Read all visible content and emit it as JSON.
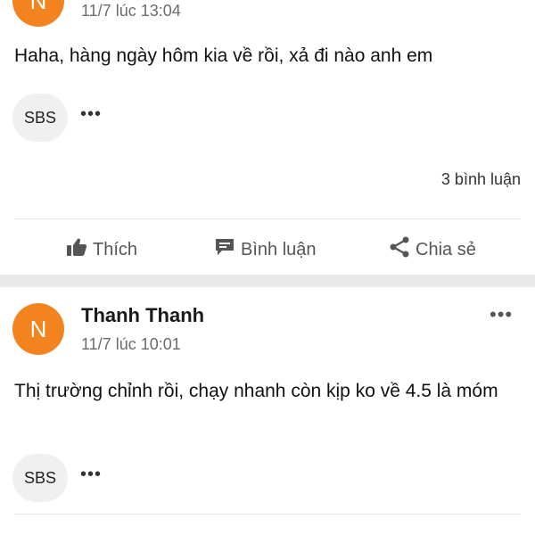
{
  "post1": {
    "time": "11/7 lúc 13:04",
    "content": "Haha, hàng ngày hôm kia về rồi, xả đi nào anh em",
    "tag": "SBS",
    "comment_count": "3 bình luận",
    "actions": {
      "like": "Thích",
      "comment": "Bình luận",
      "share": "Chia sẻ"
    }
  },
  "post2": {
    "avatar_letter": "N",
    "author": "Thanh Thanh",
    "time": "11/7 lúc 10:01",
    "content": "Thị trường chỉnh rồi, chạy nhanh còn kịp ko về 4.5 là móm",
    "tag": "SBS"
  },
  "post1_avatar_letter": "N",
  "colors": {
    "avatar": "#f2831f",
    "separator": "#e9e9e9",
    "icon": "#555555"
  }
}
